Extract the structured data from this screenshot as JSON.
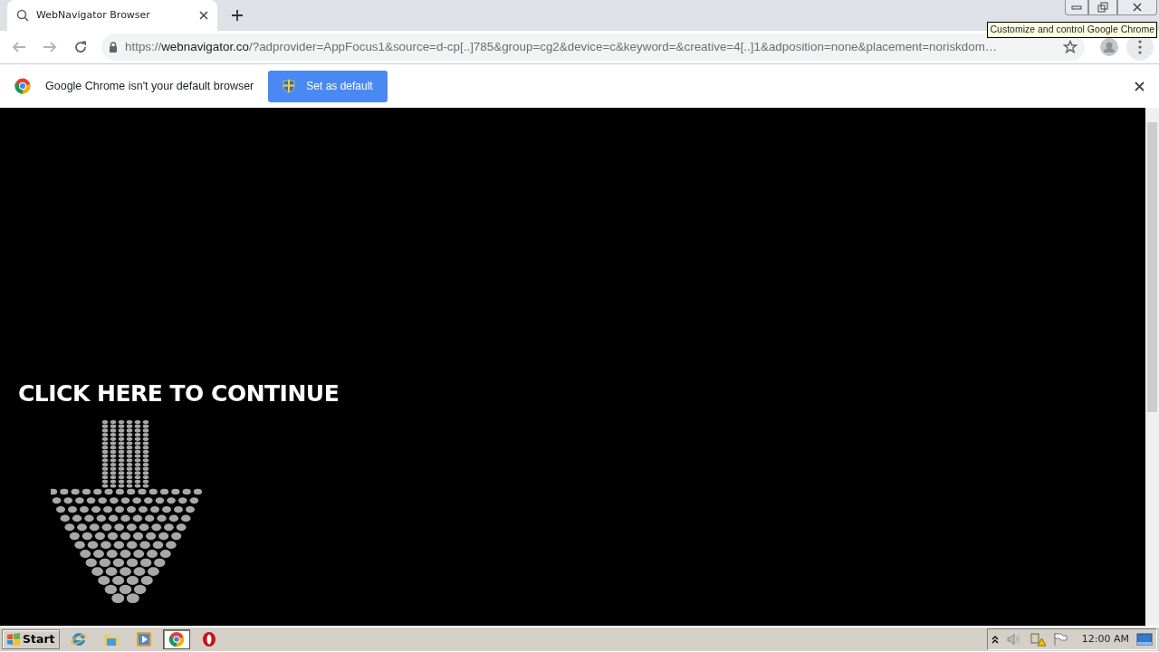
{
  "tabs": [
    {
      "title": "WebNavigator Browser",
      "selected": true
    }
  ],
  "address_bar": {
    "scheme": "https://",
    "host": "webnavigator.co",
    "rest": "/?adprovider=AppFocus1&source=d-cp[..]785&group=cg2&device=c&keyword=&creative=4[..]1&adposition=none&placement=noriskdom…"
  },
  "tooltip": "Customize and control Google Chrome",
  "infobar": {
    "message": "Google Chrome isn't your default browser",
    "button": "Set as default"
  },
  "page": {
    "heading": "CLICK HERE TO CONTINUE"
  },
  "taskbar": {
    "start": "Start",
    "apps": [
      {
        "kind": "ie",
        "selected": false
      },
      {
        "kind": "folder",
        "selected": false
      },
      {
        "kind": "media",
        "selected": false
      },
      {
        "kind": "chrome",
        "selected": true
      },
      {
        "kind": "opera",
        "selected": false
      }
    ],
    "clock": "12:00 AM"
  }
}
